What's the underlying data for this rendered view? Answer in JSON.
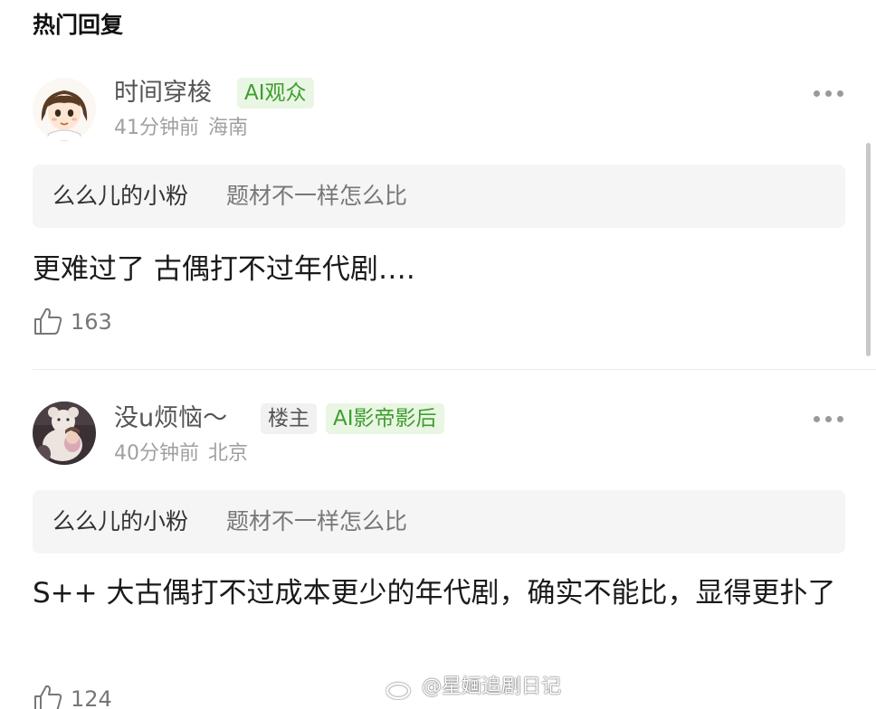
{
  "header": {
    "title": "热门回复"
  },
  "icons": {
    "more": "more-horizontal-icon",
    "like": "thumbs-up-icon",
    "watermark": "weibo-logo-icon"
  },
  "colors": {
    "badge_ai_bg": "#e9f6e3",
    "badge_ai_text": "#3f9d2f",
    "meta_text": "#a0a0a0"
  },
  "comments": [
    {
      "username": "时间穿梭",
      "badges": [
        "AI观众"
      ],
      "time": "41分钟前",
      "location": "海南",
      "quote_user": "么么儿的小粉",
      "quote_text": "题材不一样怎么比",
      "text": "更难过了 古偶打不过年代剧….",
      "likes": "163"
    },
    {
      "username": "没u烦恼～",
      "badges": [
        "楼主",
        "AI影帝影后"
      ],
      "time": "40分钟前",
      "location": "北京",
      "quote_user": "么么儿的小粉",
      "quote_text": "题材不一样怎么比",
      "text": "S++ 大古偶打不过成本更少的年代剧，确实不能比，显得更扑了",
      "likes": "124"
    }
  ],
  "watermark": {
    "text": "@星婳追剧日记"
  }
}
